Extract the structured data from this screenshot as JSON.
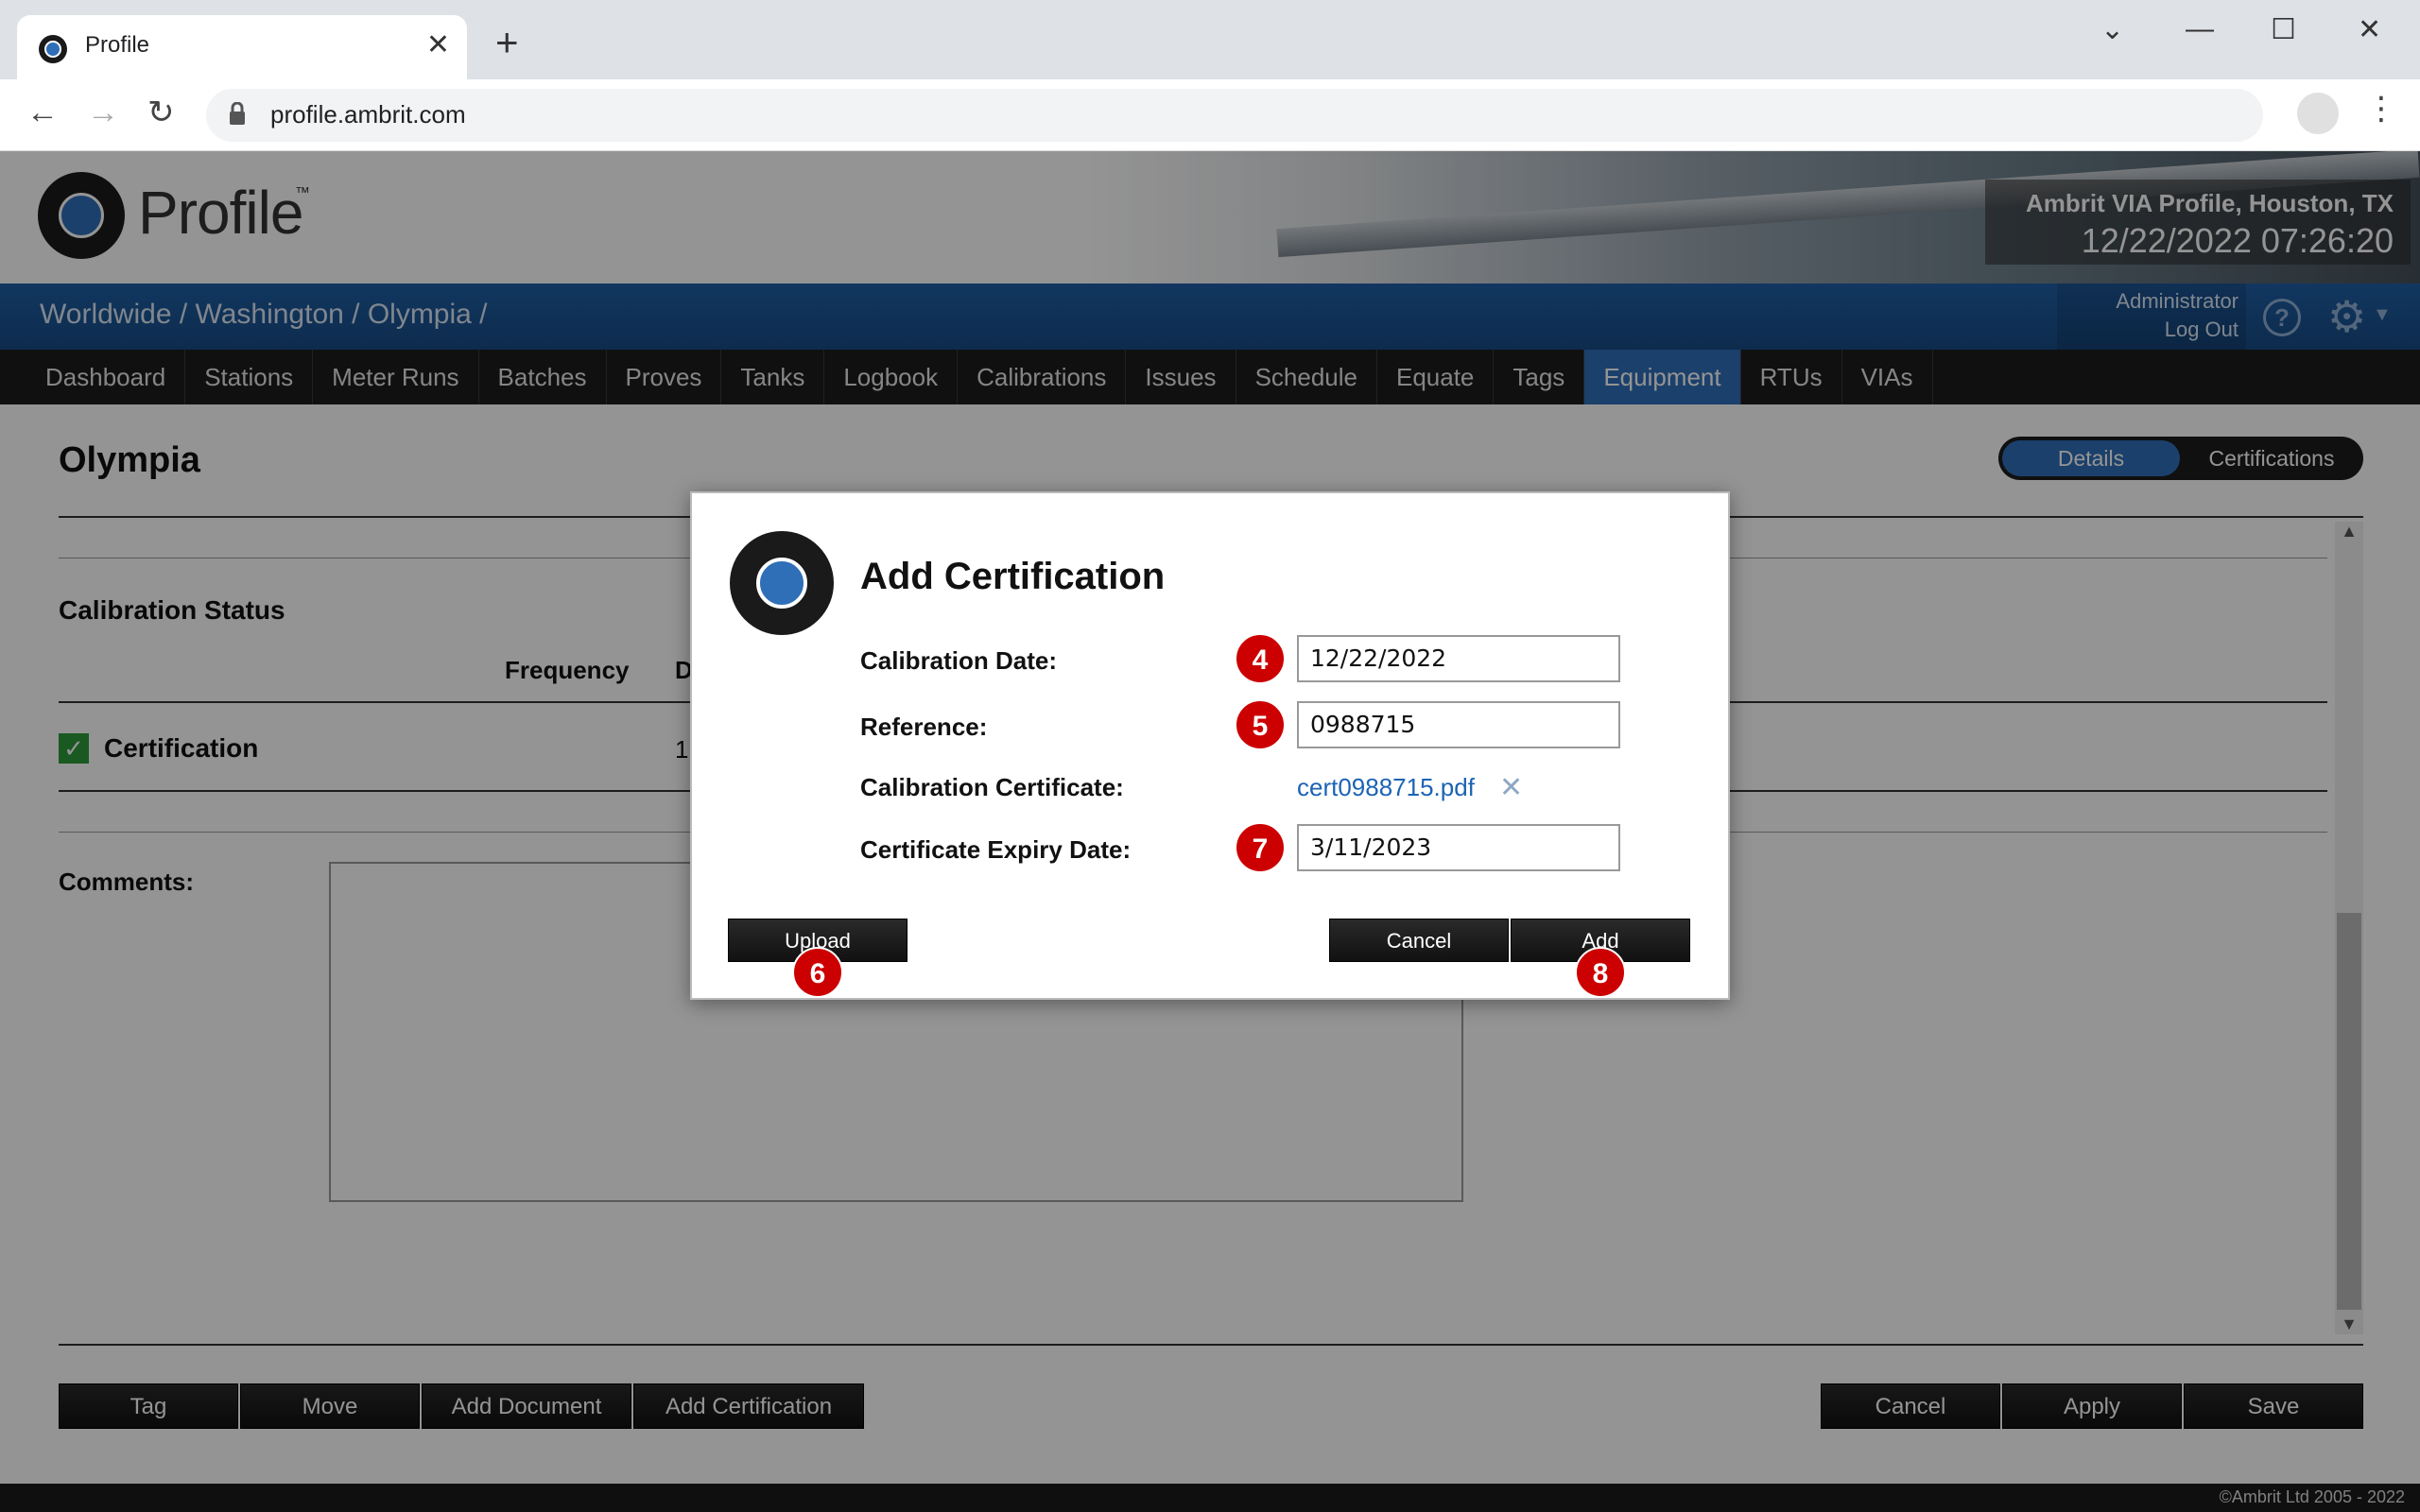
{
  "browser": {
    "tab_title": "Profile",
    "url": "profile.ambrit.com"
  },
  "header": {
    "logo_text": "Profile",
    "logo_tm": "™",
    "site_name": "Ambrit VIA Profile, Houston, TX",
    "site_time": "12/22/2022 07:26:20"
  },
  "breadcrumb": "Worldwide / Washington / Olympia /",
  "user": {
    "name": "Administrator",
    "logout": "Log Out",
    "help": "?"
  },
  "nav": [
    "Dashboard",
    "Stations",
    "Meter Runs",
    "Batches",
    "Proves",
    "Tanks",
    "Logbook",
    "Calibrations",
    "Issues",
    "Schedule",
    "Equate",
    "Tags",
    "Equipment",
    "RTUs",
    "VIAs"
  ],
  "nav_active": "Equipment",
  "page": {
    "title": "Olympia",
    "toggle_details": "Details",
    "toggle_certifications": "Certifications",
    "section_title": "Calibration Status",
    "col_frequency": "Frequency",
    "col_d": "D",
    "cert_label": "Certification",
    "cert_value": "1",
    "comments_label": "Comments:"
  },
  "bottom_buttons": {
    "tag": "Tag",
    "move": "Move",
    "add_document": "Add Document",
    "add_certification": "Add Certification",
    "cancel": "Cancel",
    "apply": "Apply",
    "save": "Save"
  },
  "footer": "©Ambrit Ltd 2005 - 2022",
  "dialog": {
    "title": "Add Certification",
    "calibration_date_label": "Calibration Date:",
    "calibration_date_value": "12/22/2022",
    "reference_label": "Reference:",
    "reference_value": "0988715",
    "certificate_label": "Calibration Certificate:",
    "certificate_file": "cert0988715.pdf",
    "expiry_label": "Certificate Expiry Date:",
    "expiry_value": "3/11/2023",
    "upload_button": "Upload",
    "cancel_button": "Cancel",
    "add_button": "Add",
    "markers": [
      "4",
      "5",
      "6",
      "7",
      "8"
    ]
  }
}
